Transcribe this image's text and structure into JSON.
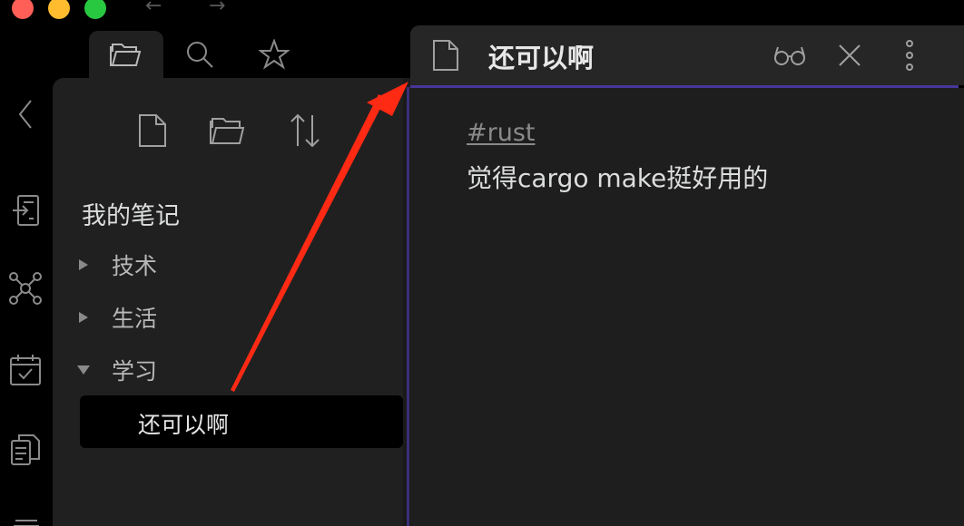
{
  "window": {
    "nav_back": "←",
    "nav_forward": "→"
  },
  "sidebar_tabs": [
    "files-icon",
    "search-icon",
    "star-icon"
  ],
  "ribbon": [
    "collapse-chevron-icon",
    "open-note-icon",
    "graph-icon",
    "calendar-icon",
    "copy-note-icon",
    "note-stack-icon"
  ],
  "explorer": {
    "toolbar": [
      "new-note-icon",
      "new-folder-icon",
      "sort-icon"
    ],
    "vault_name": "我的笔记",
    "folders": [
      {
        "label": "技术",
        "expanded": false
      },
      {
        "label": "生活",
        "expanded": false
      },
      {
        "label": "学习",
        "expanded": true
      }
    ],
    "active_file": "还可以啊"
  },
  "editor": {
    "title": "还可以啊",
    "tag": "#rust",
    "text": "觉得cargo make挺好用的",
    "actions": [
      "reading-view-icon",
      "close-icon",
      "more-options-icon"
    ]
  },
  "colors": {
    "accent": "#483699",
    "annotation": "#ff2a14"
  }
}
